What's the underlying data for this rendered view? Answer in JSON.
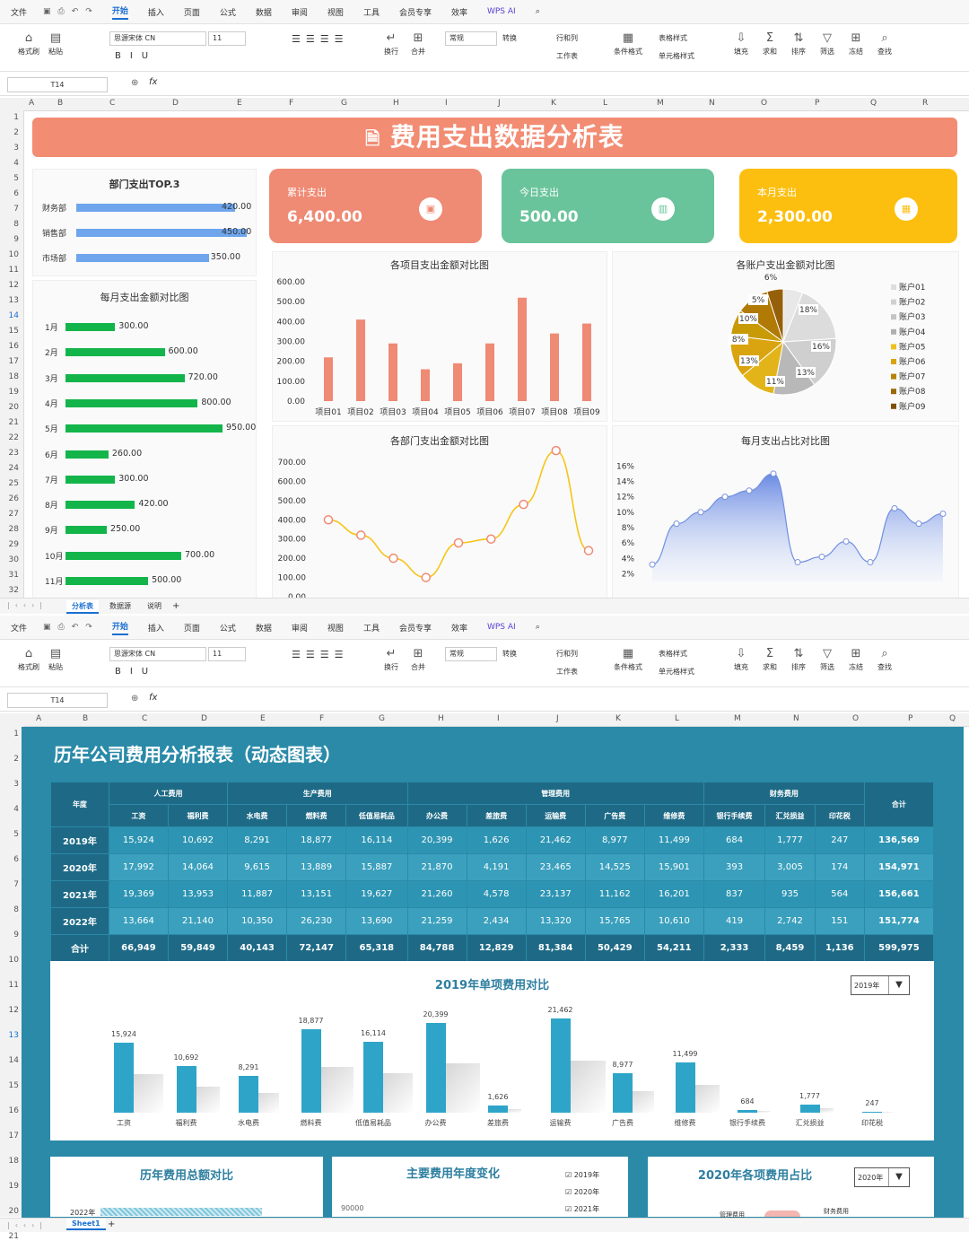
{
  "menu": {
    "items": [
      "文件",
      "开始",
      "插入",
      "页面",
      "公式",
      "数据",
      "审阅",
      "视图",
      "工具",
      "会员专享",
      "效率",
      "WPS AI"
    ],
    "active": "开始"
  },
  "ribbon": {
    "font_name": "思源宋体 CN",
    "font_size": "11",
    "number_format": "常规",
    "buttons": [
      "格式刷",
      "粘贴",
      "换行",
      "合并",
      "转换",
      "行和列",
      "工作表",
      "条件格式",
      "表格样式",
      "单元格样式",
      "填充",
      "求和",
      "排序",
      "筛选",
      "冻结",
      "查找"
    ]
  },
  "formula_bar": {
    "cell": "T14",
    "fx": "fx"
  },
  "grid1": {
    "cols": [
      "A",
      "B",
      "C",
      "D",
      "E",
      "F",
      "G",
      "H",
      "I",
      "J",
      "K",
      "L",
      "M",
      "N",
      "O",
      "P",
      "Q",
      "R"
    ],
    "rows": [
      "1",
      "2",
      "3",
      "4",
      "5",
      "6",
      "7",
      "8",
      "9",
      "10",
      "11",
      "12",
      "13",
      "14",
      "15",
      "16",
      "17",
      "18",
      "19",
      "20",
      "21",
      "22",
      "23",
      "24",
      "25",
      "26",
      "27",
      "28",
      "29",
      "30",
      "31",
      "32"
    ],
    "selected_row": "14"
  },
  "dashboard1": {
    "title": "费用支出数据分析表",
    "top3": {
      "title": "部门支出TOP.3",
      "items": [
        {
          "name": "财务部",
          "value": "420.00",
          "v": 420
        },
        {
          "name": "销售部",
          "value": "450.00",
          "v": 450
        },
        {
          "name": "市场部",
          "value": "350.00",
          "v": 350
        }
      ]
    },
    "kpis": [
      {
        "label": "累计支出",
        "value": "6,400.00",
        "color": "#ef8a74"
      },
      {
        "label": "今日支出",
        "value": "500.00",
        "color": "#6ac49b"
      },
      {
        "label": "本月支出",
        "value": "2,300.00",
        "color": "#fdbf0f"
      }
    ],
    "monthly": {
      "title": "每月支出金额对比图",
      "items": [
        {
          "m": "1月",
          "v": 300,
          "t": "300.00"
        },
        {
          "m": "2月",
          "v": 600,
          "t": "600.00"
        },
        {
          "m": "3月",
          "v": 720,
          "t": "720.00"
        },
        {
          "m": "4月",
          "v": 800,
          "t": "800.00"
        },
        {
          "m": "5月",
          "v": 950,
          "t": "950.00"
        },
        {
          "m": "6月",
          "v": 260,
          "t": "260.00"
        },
        {
          "m": "7月",
          "v": 300,
          "t": "300.00"
        },
        {
          "m": "8月",
          "v": 420,
          "t": "420.00"
        },
        {
          "m": "9月",
          "v": 250,
          "t": "250.00"
        },
        {
          "m": "10月",
          "v": 700,
          "t": "700.00"
        },
        {
          "m": "11月",
          "v": 500,
          "t": "500.00"
        }
      ]
    }
  },
  "chart_data": [
    {
      "type": "bar",
      "title": "各项目支出金额对比图",
      "categories": [
        "项目01",
        "项目02",
        "项目03",
        "项目04",
        "项目05",
        "项目06",
        "项目07",
        "项目08",
        "项目09"
      ],
      "values": [
        220,
        410,
        290,
        160,
        190,
        290,
        520,
        340,
        390
      ],
      "ylim": [
        0,
        600
      ],
      "yticks": [
        "0.00",
        "100.00",
        "200.00",
        "300.00",
        "400.00",
        "500.00",
        "600.00"
      ],
      "color": "#ef8a74"
    },
    {
      "type": "pie",
      "title": "各账户支出金额对比图",
      "categories": [
        "账户01",
        "账户02",
        "账户03",
        "账户04",
        "账户05",
        "账户06",
        "账户07",
        "账户08",
        "账户09"
      ],
      "values": [
        6,
        18,
        16,
        13,
        11,
        13,
        8,
        10,
        5
      ],
      "labels": [
        "6%",
        "18%",
        "16%",
        "13%",
        "11%",
        "13%",
        "8%",
        "10%",
        "5%"
      ]
    },
    {
      "type": "line",
      "title": "各部门支出金额对比图",
      "values": [
        400,
        320,
        200,
        100,
        280,
        300,
        480,
        760,
        240
      ],
      "ylim": [
        0,
        700
      ],
      "yticks": [
        "0.00",
        "100.00",
        "200.00",
        "300.00",
        "400.00",
        "500.00",
        "600.00",
        "700.00"
      ],
      "color": "#f5c518"
    },
    {
      "type": "area",
      "title": "每月支出占比对比图",
      "values": [
        3.2,
        8.5,
        10,
        12,
        12.8,
        15,
        3.5,
        4.2,
        6.2,
        3.5,
        10.5,
        8.5,
        9.8
      ],
      "yticks": [
        "2%",
        "4%",
        "6%",
        "8%",
        "10%",
        "12%",
        "14%",
        "16%"
      ],
      "ylim": [
        1,
        16.5
      ],
      "color": "#6f8fe0"
    },
    {
      "type": "bar",
      "title": "2019年单项费用对比",
      "categories": [
        "工资",
        "福利费",
        "水电费",
        "燃料费",
        "低值易耗品",
        "办公费",
        "差旅费",
        "运输费",
        "广告费",
        "维修费",
        "银行手续费",
        "汇兑损益",
        "印花税"
      ],
      "values": [
        15924,
        10692,
        8291,
        18877,
        16114,
        20399,
        1626,
        21462,
        8977,
        11499,
        684,
        1777,
        247
      ],
      "labels": [
        "15,924",
        "10,692",
        "8,291",
        "18,877",
        "16,114",
        "20,399",
        "1,626",
        "21,462",
        "8,977",
        "11,499",
        "684",
        "1,777",
        "247"
      ]
    }
  ],
  "sheet_tabs1": [
    "分析表",
    "数据源",
    "说明"
  ],
  "grid2": {
    "cols": [
      "A",
      "B",
      "C",
      "D",
      "E",
      "F",
      "G",
      "H",
      "I",
      "J",
      "K",
      "L",
      "M",
      "N",
      "O",
      "P",
      "Q"
    ],
    "rows": [
      "1",
      "2",
      "3",
      "4",
      "5",
      "6",
      "7",
      "8",
      "9",
      "10",
      "11",
      "12",
      "13",
      "14",
      "15",
      "16",
      "17",
      "18",
      "19",
      "20",
      "21"
    ],
    "selected_row": "13"
  },
  "dashboard2": {
    "title": "历年公司费用分析报表（动态图表）",
    "groups": [
      "人工费用",
      "生产费用",
      "管理费用",
      "财务费用"
    ],
    "year_hdr": "年度",
    "total_hdr": "合计",
    "cols": [
      "工资",
      "福利费",
      "水电费",
      "燃料费",
      "低值易耗品",
      "办公费",
      "差旅费",
      "运输费",
      "广告费",
      "维修费",
      "银行手续费",
      "汇兑损益",
      "印花税"
    ],
    "rows": [
      {
        "y": "2019年",
        "v": [
          "15,924",
          "10,692",
          "8,291",
          "18,877",
          "16,114",
          "20,399",
          "1,626",
          "21,462",
          "8,977",
          "11,499",
          "684",
          "1,777",
          "247"
        ],
        "t": "136,569"
      },
      {
        "y": "2020年",
        "v": [
          "17,992",
          "14,064",
          "9,615",
          "13,889",
          "15,887",
          "21,870",
          "4,191",
          "23,465",
          "14,525",
          "15,901",
          "393",
          "3,005",
          "174"
        ],
        "t": "154,971"
      },
      {
        "y": "2021年",
        "v": [
          "19,369",
          "13,953",
          "11,887",
          "13,151",
          "19,627",
          "21,260",
          "4,578",
          "23,137",
          "11,162",
          "16,201",
          "837",
          "935",
          "564"
        ],
        "t": "156,661"
      },
      {
        "y": "2022年",
        "v": [
          "13,664",
          "21,140",
          "10,350",
          "26,230",
          "13,690",
          "21,259",
          "2,434",
          "13,320",
          "15,765",
          "10,610",
          "419",
          "2,742",
          "151"
        ],
        "t": "151,774"
      },
      {
        "y": "合计",
        "v": [
          "66,949",
          "59,849",
          "40,143",
          "72,147",
          "65,318",
          "84,788",
          "12,829",
          "81,384",
          "50,429",
          "54,211",
          "2,333",
          "8,459",
          "1,136"
        ],
        "t": "599,975"
      }
    ],
    "year_select": "2019年",
    "bottom": {
      "p1": "历年费用总额对比",
      "p1_first": "2022年",
      "p2": "主要费用年度变化",
      "p2_tick": "90000",
      "p2_legend": [
        "2019年",
        "2020年",
        "2021年"
      ],
      "p3": "2020年各项费用占比",
      "p3_select": "2020年",
      "p3_lbl1": "管理费用",
      "p3_lbl2": "财务费用"
    }
  },
  "sheet_tabs2": [
    "Sheet1"
  ]
}
